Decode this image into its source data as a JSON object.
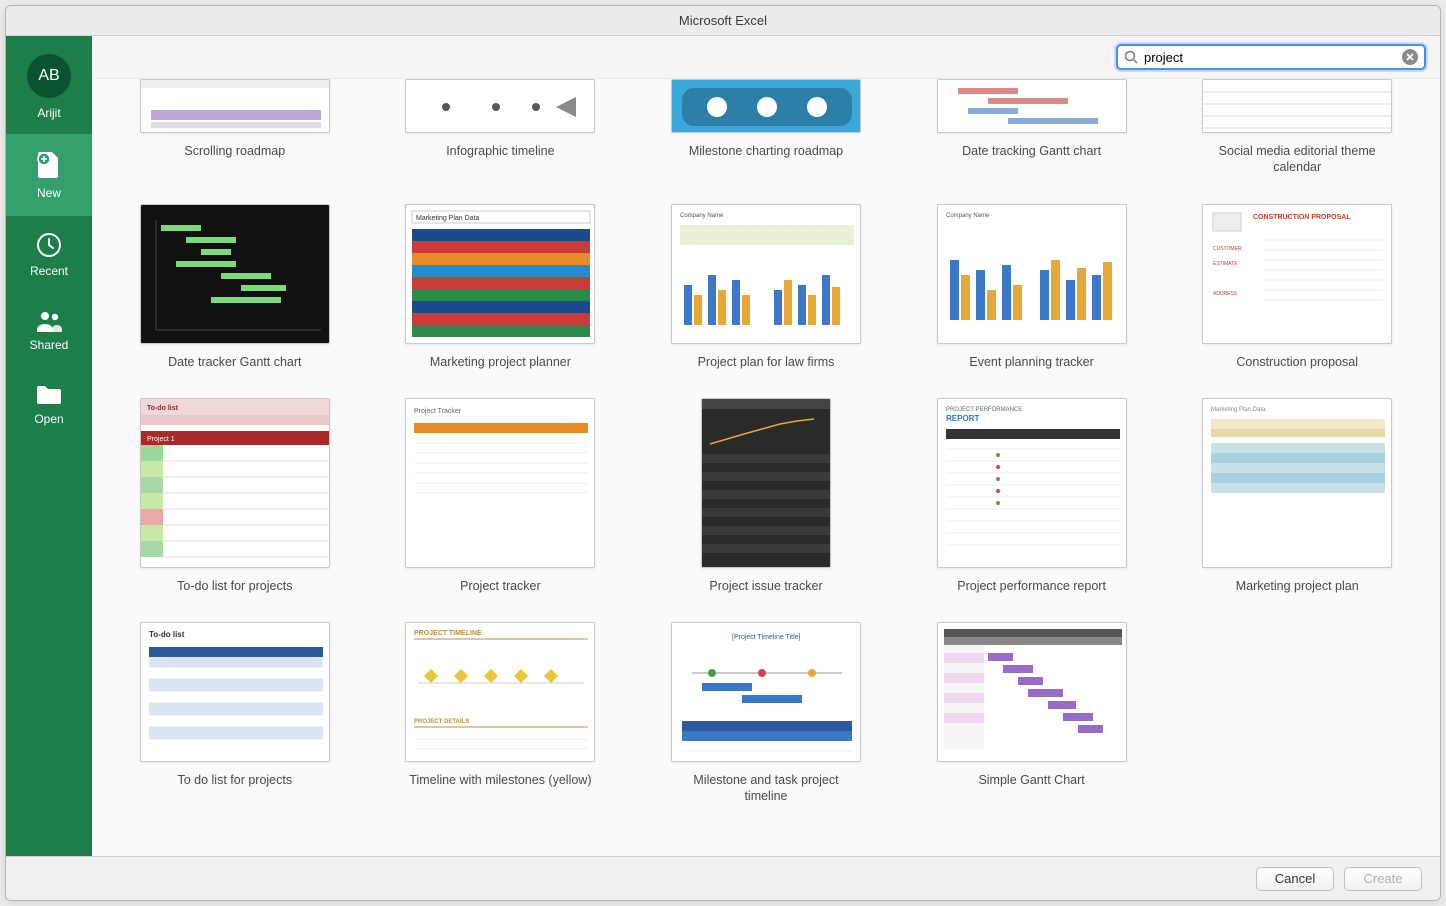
{
  "window": {
    "title": "Microsoft Excel"
  },
  "user": {
    "initials": "AB",
    "name": "Arijit"
  },
  "sidebar": {
    "items": [
      {
        "label": "New",
        "icon": "file-plus-icon",
        "active": true
      },
      {
        "label": "Recent",
        "icon": "clock-icon",
        "active": false
      },
      {
        "label": "Shared",
        "icon": "people-icon",
        "active": false
      },
      {
        "label": "Open",
        "icon": "folder-icon",
        "active": false
      }
    ]
  },
  "search": {
    "value": "project",
    "placeholder": "Search"
  },
  "templates": [
    {
      "label": "Scrolling roadmap",
      "kind": "roadmap"
    },
    {
      "label": "Infographic timeline",
      "kind": "timeline"
    },
    {
      "label": "Milestone charting roadmap",
      "kind": "roadmap-blue"
    },
    {
      "label": "Date tracking Gantt chart",
      "kind": "gantt-light"
    },
    {
      "label": "Social media editorial theme calendar",
      "kind": "calendar"
    },
    {
      "label": "Date tracker Gantt chart",
      "kind": "gantt-dark"
    },
    {
      "label": "Marketing project planner",
      "kind": "planner"
    },
    {
      "label": "Project plan for law firms",
      "kind": "bars-duo"
    },
    {
      "label": "Event planning tracker",
      "kind": "bars-duo2"
    },
    {
      "label": "Construction proposal",
      "kind": "proposal"
    },
    {
      "label": "To-do list for projects",
      "kind": "todo-red"
    },
    {
      "label": "Project tracker",
      "kind": "tracker"
    },
    {
      "label": "Project issue tracker",
      "kind": "issue-dark"
    },
    {
      "label": "Project performance report",
      "kind": "perf"
    },
    {
      "label": "Marketing project plan",
      "kind": "plan-pastel"
    },
    {
      "label": "To do list for projects",
      "kind": "todo-blue"
    },
    {
      "label": "Timeline with milestones (yellow)",
      "kind": "milestones"
    },
    {
      "label": "Milestone and task project timeline",
      "kind": "task-timeline"
    },
    {
      "label": "Simple Gantt Chart",
      "kind": "gantt-simple"
    }
  ],
  "footer": {
    "cancel": "Cancel",
    "create": "Create"
  }
}
